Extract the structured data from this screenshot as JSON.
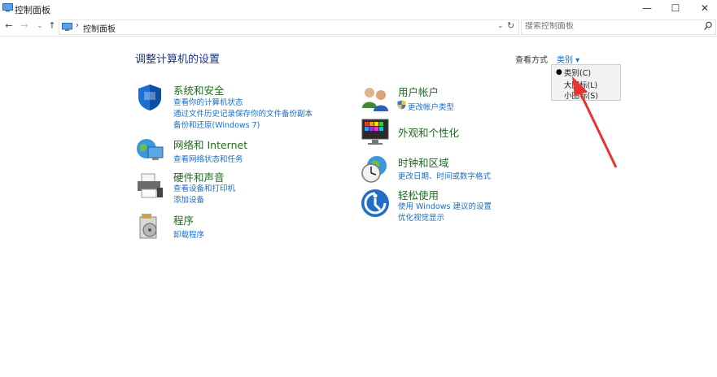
{
  "window": {
    "title": "控制面板"
  },
  "address": {
    "crumb": "控制面板",
    "search_placeholder": "搜索控制面板"
  },
  "page": {
    "title": "调整计算机的设置"
  },
  "viewby": {
    "label": "查看方式",
    "value": "类别",
    "options": [
      "类别(C)",
      "大图标(L)",
      "小图标(S)"
    ],
    "selected": 0
  },
  "categories": [
    {
      "title": "系统和安全",
      "links": [
        "查看你的计算机状态",
        "通过文件历史记录保存你的文件备份副本",
        "备份和还原(Windows 7)"
      ]
    },
    {
      "title": "网络和 Internet",
      "links": [
        "查看网络状态和任务"
      ]
    },
    {
      "title": "硬件和声音",
      "links": [
        "查看设备和打印机",
        "添加设备"
      ]
    },
    {
      "title": "程序",
      "links": [
        "卸载程序"
      ]
    },
    {
      "title": "用户帐户",
      "links": [
        "更改帐户类型"
      ]
    },
    {
      "title": "外观和个性化",
      "links": []
    },
    {
      "title": "时钟和区域",
      "links": [
        "更改日期、时间或数字格式"
      ]
    },
    {
      "title": "轻松使用",
      "links": [
        "使用 Windows 建议的设置",
        "优化视觉显示"
      ]
    }
  ],
  "colors": {
    "accent": "#1a6fc9",
    "category_title": "#1e6b1e",
    "page_title": "#1e3287",
    "annotation_arrow": "#e8332e"
  }
}
